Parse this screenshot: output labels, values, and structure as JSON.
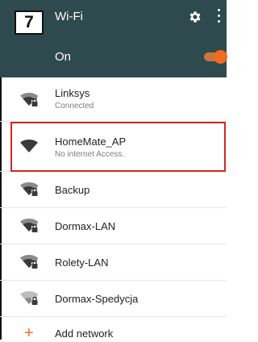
{
  "step_badge": "7",
  "header": {
    "title": "Wi-Fi",
    "gear_icon": "gear-icon",
    "menu_icon": "more-vert-icon"
  },
  "toggle_row": {
    "label": "On",
    "state": "on",
    "accent": "#f06a20"
  },
  "networks": [
    {
      "name": "Linksys",
      "status": "Connected",
      "icon": "wifi-lock-icon"
    },
    {
      "name": "HomeMate_AP",
      "status": "No internet Access.",
      "icon": "wifi-icon",
      "highlighted": true
    },
    {
      "name": "Backup",
      "status": "",
      "icon": "wifi-lock-icon"
    },
    {
      "name": "Dormax-LAN",
      "status": "",
      "icon": "wifi-lock-icon"
    },
    {
      "name": "Rolety-LAN",
      "status": "",
      "icon": "wifi-lock-icon"
    },
    {
      "name": "Dormax-Spedycja",
      "status": "",
      "icon": "wifi-lock-icon"
    }
  ],
  "add_network": {
    "label": "Add network",
    "icon": "plus-icon"
  },
  "colors": {
    "appbar": "#2f4a4e",
    "highlight_border": "#d42626"
  }
}
